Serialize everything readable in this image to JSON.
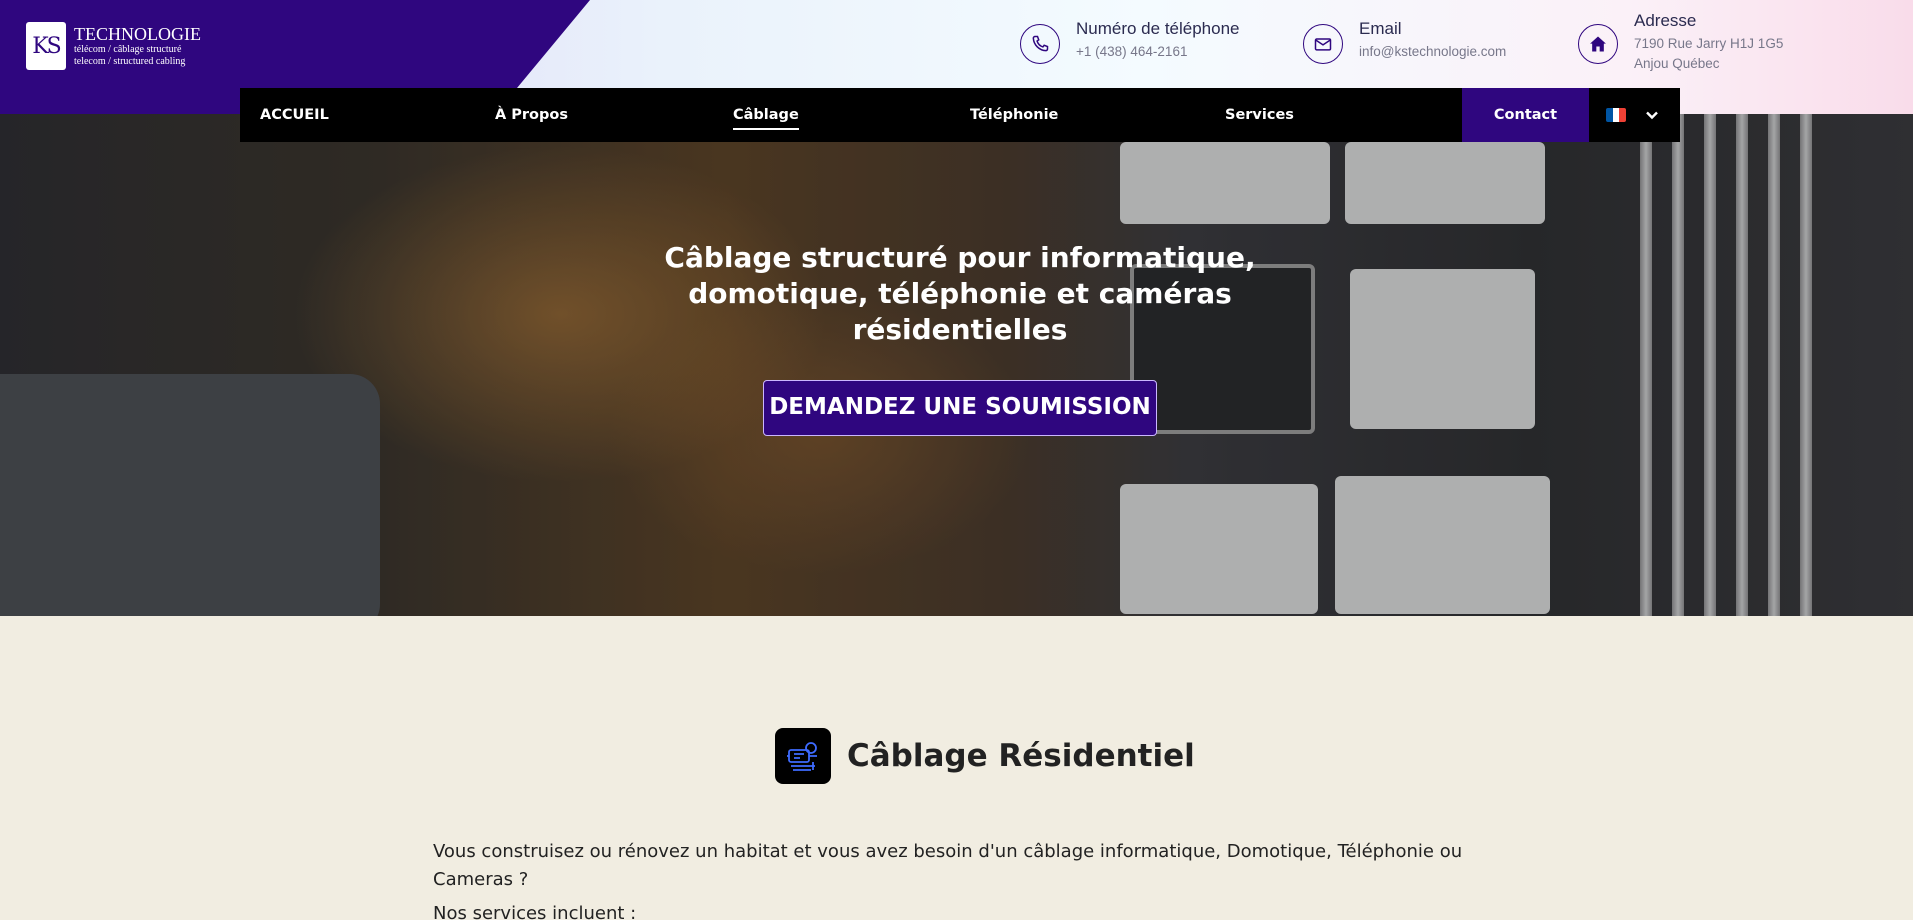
{
  "brand": {
    "mark": "KS",
    "title": "TECHNOLOGIE",
    "subtitle_1": "télécom / câblage structuré",
    "subtitle_2": "telecom / structured cabling"
  },
  "contacts": {
    "phone": {
      "label": "Numéro de téléphone",
      "value": "+1 (438) 464-2161",
      "icon": "phone-icon"
    },
    "email": {
      "label": "Email",
      "value": "info@kstechnologie.com",
      "icon": "envelope-icon"
    },
    "address": {
      "label": "Adresse",
      "line1": "7190 Rue Jarry H1J 1G5",
      "line2": "Anjou Québec",
      "icon": "house-icon"
    }
  },
  "nav": {
    "items": [
      {
        "label": "ACCUEIL",
        "active": false
      },
      {
        "label": "À Propos",
        "active": false
      },
      {
        "label": "Câblage",
        "active": true
      },
      {
        "label": "Téléphonie",
        "active": false
      },
      {
        "label": "Services",
        "active": false
      }
    ],
    "contact_label": "Contact",
    "language": "fr",
    "flag_colors": [
      "#0055a4",
      "#ffffff",
      "#ef4135"
    ]
  },
  "hero": {
    "title": "Câblage structuré pour informatique, domotique, téléphonie et caméras résidentielles",
    "cta_label": "DEMANDEZ UNE SOUMISSION"
  },
  "section": {
    "icon": "cabling-icon",
    "title": "Câblage Résidentiel",
    "paragraph": "Vous construisez ou rénovez un habitat et vous avez besoin d'un câblage informatique, Domotique, Téléphonie ou Cameras ?",
    "services_intro": "Nos services incluent :"
  },
  "colors": {
    "brand_purple": "#2f067f",
    "nav_bg": "#000000",
    "page_bg": "#f1ede1"
  }
}
